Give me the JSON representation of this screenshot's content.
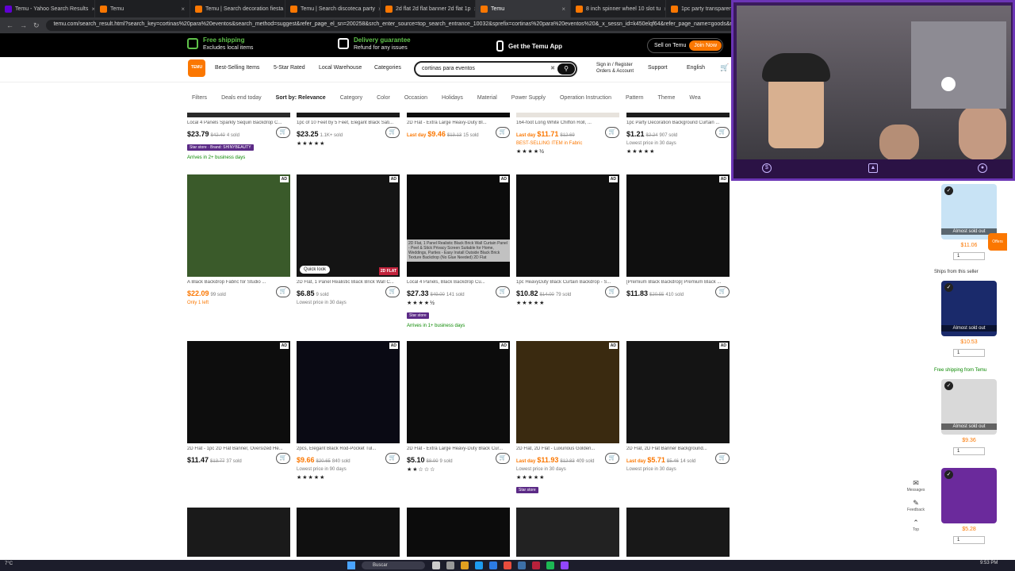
{
  "browser": {
    "tabs": [
      {
        "label": "Temu - Yahoo Search Results",
        "fav": "yahoo",
        "active": false
      },
      {
        "label": "Temu",
        "fav": "temu",
        "active": false
      },
      {
        "label": "Temu | Search decoration fiesta",
        "fav": "temu",
        "active": false
      },
      {
        "label": "Temu | Search discoteca party",
        "fav": "temu",
        "active": false
      },
      {
        "label": "2d flat 2d flat banner 2d flat 1p",
        "fav": "temu",
        "active": false
      },
      {
        "label": "Temu",
        "fav": "temu",
        "active": true
      },
      {
        "label": "8 inch spinner wheel 10 slot tu",
        "fav": "temu",
        "active": false
      },
      {
        "label": "1pc party transparent ice b",
        "fav": "temu",
        "active": false
      }
    ],
    "url": "temu.com/search_result.html?search_key=cortinas%20para%20eventos&search_method=suggest&refer_page_el_sn=200258&srch_enter_source=top_search_entrance_10032&sprefix=cortinas%20para%20eventos%20&_x_sessn_id=k450elqf64&refer_page_name=goods&refere"
  },
  "promo": {
    "free_shipping": "Free shipping",
    "free_shipping_sub": "Excludes local items",
    "delivery": "Delivery guarantee",
    "delivery_sub": "Refund for any issues",
    "app": "Get the Temu App",
    "sell": "Sell on Temu",
    "join": "Join Now"
  },
  "header": {
    "logo": "TEMU",
    "best_selling": "Best-Selling Items",
    "five_star": "5-Star Rated",
    "local_warehouse": "Local Warehouse",
    "categories": "Categories",
    "search_value": "cortinas para eventos",
    "signin_top": "Sign in / Register",
    "signin_bottom": "Orders & Account",
    "support": "Support",
    "language": "English"
  },
  "filters": [
    "Filters",
    "Deals end today",
    "Sort by: Relevance",
    "Category",
    "Color",
    "Occasion",
    "Holidays",
    "Material",
    "Power Supply",
    "Operation Instruction",
    "Pattern",
    "Theme",
    "Wea"
  ],
  "row0": [
    {
      "title": "Local 4 Panels Sparkly Sequin Backdrop C...",
      "price": "$23.79",
      "old": "$42.40",
      "sold": "4 sold",
      "orange": false,
      "extra": [
        "Star store · Brand: SHINYBEAUTY",
        "Arrives in 2+ business days"
      ]
    },
    {
      "title": "1pc of 10 Feet by 5 Feet, Elegant Black Sati...",
      "price": "$23.25",
      "old": "",
      "sold": "1.1K+ sold",
      "orange": false,
      "extra": [
        "★★★★★"
      ]
    },
    {
      "title": "2D Flat - Extra Large Heavy-Duty Bl...",
      "price": "$9.46",
      "old": "$13.13",
      "sold": "15 sold",
      "orange": true,
      "extra": [],
      "label": "Last day"
    },
    {
      "title": "164-foot Long White Chiffon Roll, ...",
      "price": "$11.71",
      "old": "$12.69",
      "sold": "",
      "orange": true,
      "extra": [
        "BEST-SELLING ITEM in Fabric",
        "★★★★½"
      ],
      "label": "Last day"
    },
    {
      "title": "1pc Party Decoration Background Curtain ...",
      "price": "$1.21",
      "old": "$2.24",
      "sold": "907 sold",
      "orange": false,
      "extra": [
        "Lowest price in 30 days",
        "★★★★★"
      ]
    }
  ],
  "row1": [
    {
      "title": "A Black Backdrop Fabric for Studio ...",
      "price": "$22.09",
      "old": "",
      "sold": "99 sold",
      "orange": true,
      "extra": [
        "Only 1 left"
      ]
    },
    {
      "title": "2D Flat, 1 Panel Realistic Black Brick Wall C...",
      "price": "$6.85",
      "old": "",
      "sold": "9 sold",
      "orange": false,
      "extra": [
        "Lowest price in 30 days"
      ],
      "quick": "Quick look"
    },
    {
      "title": "Local 4 Panels, Black Backdrop Cu...",
      "price": "$27.33",
      "old": "$49.00",
      "sold": "141 sold",
      "orange": false,
      "extra": [
        "★★★★½",
        "Star store",
        "Arrives in 1+ business days"
      ],
      "overlay": "2D Flat, 1 Panel Realistic Black Brick Wall Curtain Panel - Peel & Stick Privacy Screen Suitable for Home, Weddings, Parties - Easy Install Outside Black Brick Texture Backdrop (No Glue Needed) 2D Flat"
    },
    {
      "title": "1pc HeavyDuty Black Curtain Backdrop - S...",
      "price": "$10.82",
      "old": "$14.00",
      "sold": "79 sold",
      "orange": false,
      "extra": [
        "★★★★★"
      ]
    },
    {
      "title": "[Premium Black Backdrop] Premium Black ...",
      "price": "$11.83",
      "old": "$20.55",
      "sold": "410 sold",
      "orange": false,
      "extra": []
    }
  ],
  "row2": [
    {
      "title": "2D Flat - 1pc 2D Flat Banner, Oversized He...",
      "price": "$11.47",
      "old": "$13.77",
      "sold": "37 sold",
      "orange": false,
      "extra": []
    },
    {
      "title": "2pcs, Elegant Black Rod-Pocket Tul...",
      "price": "$9.66",
      "old": "$20.65",
      "sold": "840 sold",
      "orange": true,
      "extra": [
        "Lowest price in 90 days",
        "★★★★★"
      ]
    },
    {
      "title": "2D Flat - Extra Large Heavy-Duty Black Cur...",
      "price": "$5.10",
      "old": "$8.00",
      "sold": "9 sold",
      "orange": false,
      "extra": [
        "★★☆☆☆"
      ]
    },
    {
      "title": "2D Flat, 2D Flat - Luxurious Golden...",
      "price": "$11.93",
      "old": "$12.83",
      "sold": "409 sold",
      "orange": true,
      "extra": [
        "Lowest price in 30 days",
        "★★★★★",
        "Star store"
      ],
      "label": "Last day"
    },
    {
      "title": "2D Flat, 2D Flat Banner Background...",
      "price": "$5.71",
      "old": "$5.46",
      "sold": "14 sold",
      "orange": true,
      "extra": [
        "Lowest price in 30 days"
      ],
      "label": "Last day"
    }
  ],
  "rail": {
    "items": [
      {
        "price": "$11.06",
        "qty": "1",
        "status": "Almost sold out",
        "color": "#c8e3f5"
      },
      {
        "price": "$10.53",
        "qty": "1",
        "status": "Almost sold out",
        "color": "#1a2a6b"
      },
      {
        "price": "$9.36",
        "qty": "1",
        "status": "Almost sold out",
        "color": "#d9d9d9"
      },
      {
        "price": "$5.28",
        "qty": "1",
        "status": "",
        "color": "#6b2a9c"
      }
    ],
    "ships_from": "Ships from this seller",
    "free_ship": "Free shipping from Temu",
    "offers": "Offers"
  },
  "side_tools": [
    "Messages",
    "Feedback",
    "Top"
  ],
  "taskbar": {
    "weather": "7°C",
    "search": "Buscar",
    "time": "9:53 PM"
  }
}
